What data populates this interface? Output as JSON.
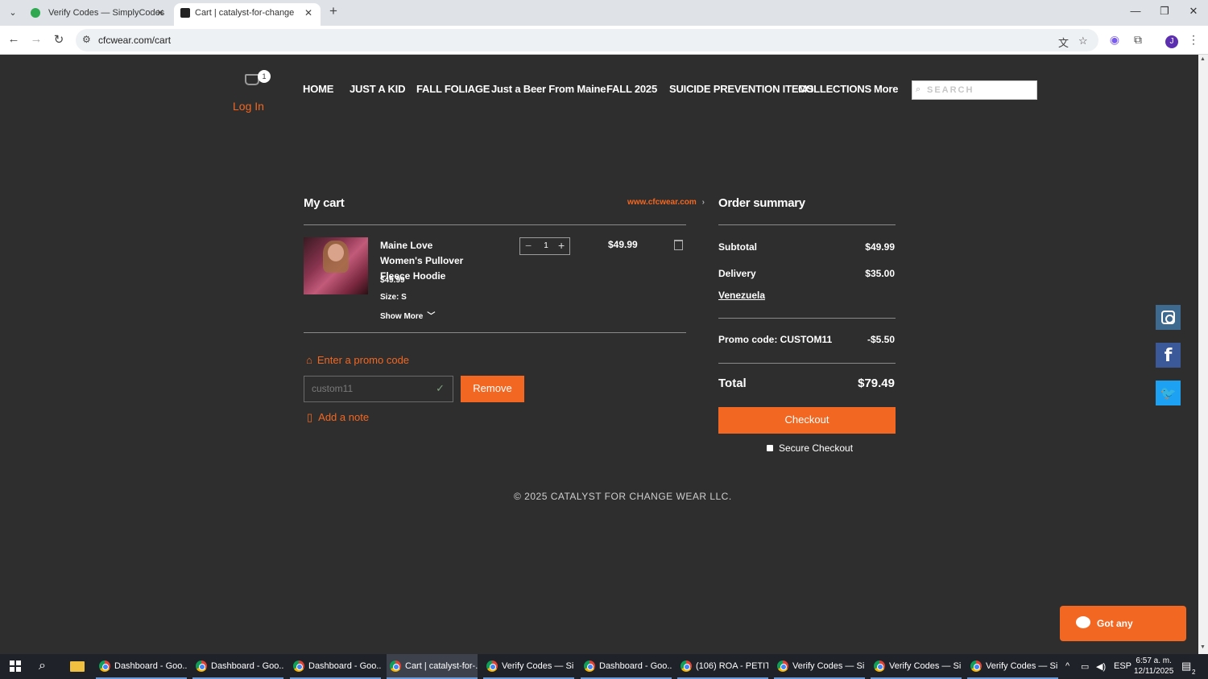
{
  "browser": {
    "tabs": [
      {
        "title": "Verify Codes — SimplyCodes",
        "active": false
      },
      {
        "title": "Cart | catalyst-for-change",
        "active": true
      }
    ],
    "url": "cfcwear.com/cart"
  },
  "site": {
    "cart_count": "1",
    "login_label": "Log In",
    "nav": [
      "HOME",
      "JUST A KID",
      "FALL FOLIAGE",
      "Just a Beer From Maine",
      "FALL 2025",
      "SUICIDE PREVENTION ITEMS",
      "COLLECTIONS",
      "More"
    ],
    "search_placeholder": "SEARCH"
  },
  "cart": {
    "title": "My cart",
    "continue_link": "www.cfcwear.com",
    "item": {
      "name": "Maine Love Women's Pullover Fleece Hoodie",
      "price": "$49.99",
      "size": "Size: S",
      "show_more": "Show More",
      "quantity": "1",
      "line_total": "$49.99"
    },
    "promo_link": "Enter a promo code",
    "promo_value": "custom11",
    "remove_label": "Remove",
    "note_link": "Add a note"
  },
  "summary": {
    "title": "Order summary",
    "subtotal_label": "Subtotal",
    "subtotal_value": "$49.99",
    "delivery_label": "Delivery",
    "delivery_value": "$35.00",
    "country": "Venezuela",
    "promo_label": "Promo code: CUSTOM11",
    "promo_value": "-$5.50",
    "total_label": "Total",
    "total_value": "$79.49",
    "checkout_label": "Checkout",
    "secure_label": "Secure Checkout"
  },
  "footer": "© 2025 CATALYST FOR CHANGE WEAR LLC.",
  "chat_label": "Got any questions?",
  "taskbar": {
    "apps": [
      "Dashboard - Goo...",
      "Dashboard - Goo...",
      "Dashboard - Goo...",
      "Cart | catalyst-for-...",
      "Verify Codes — Si...",
      "Dashboard - Goo...",
      "(106) ROA - PETIT...",
      "Verify Codes — Si...",
      "Verify Codes — Si...",
      "Verify Codes — Si..."
    ],
    "lang": "ESP",
    "time": "6:57 a. m.",
    "date": "12/11/2025",
    "notif_count": "2"
  },
  "colors": {
    "accent": "#f26722",
    "page_bg": "#2e2e2e"
  }
}
